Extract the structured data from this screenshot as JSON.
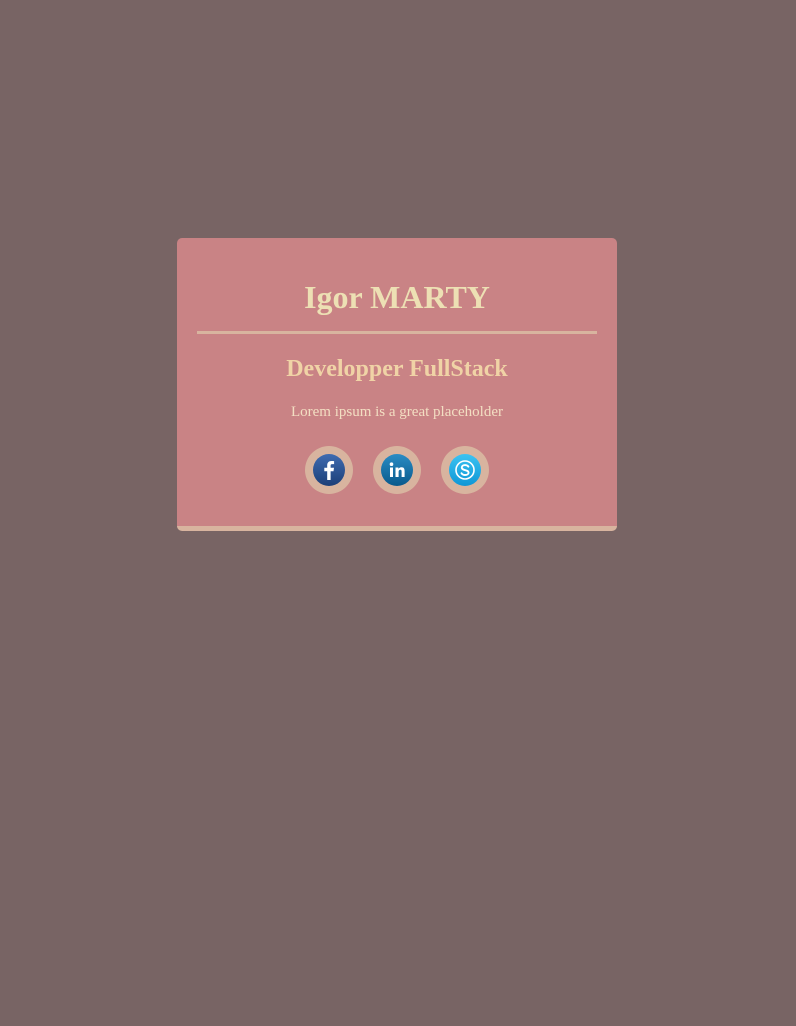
{
  "profile": {
    "name": "Igor MARTY",
    "role": "Developper FullStack",
    "tagline": "Lorem ipsum is a great placeholder"
  },
  "socials": [
    {
      "name": "facebook-icon",
      "label": "f",
      "color": "#1f4a8a"
    },
    {
      "name": "linkedin-icon",
      "label": "in",
      "color": "#0e6ca0"
    },
    {
      "name": "skype-icon",
      "label": "S",
      "color": "#12a6e6"
    }
  ],
  "colors": {
    "background": "#786464",
    "card": "#c98385",
    "accent": "#d8b49f",
    "name_text": "#ede0b4",
    "role_text": "#f0d3a6"
  }
}
